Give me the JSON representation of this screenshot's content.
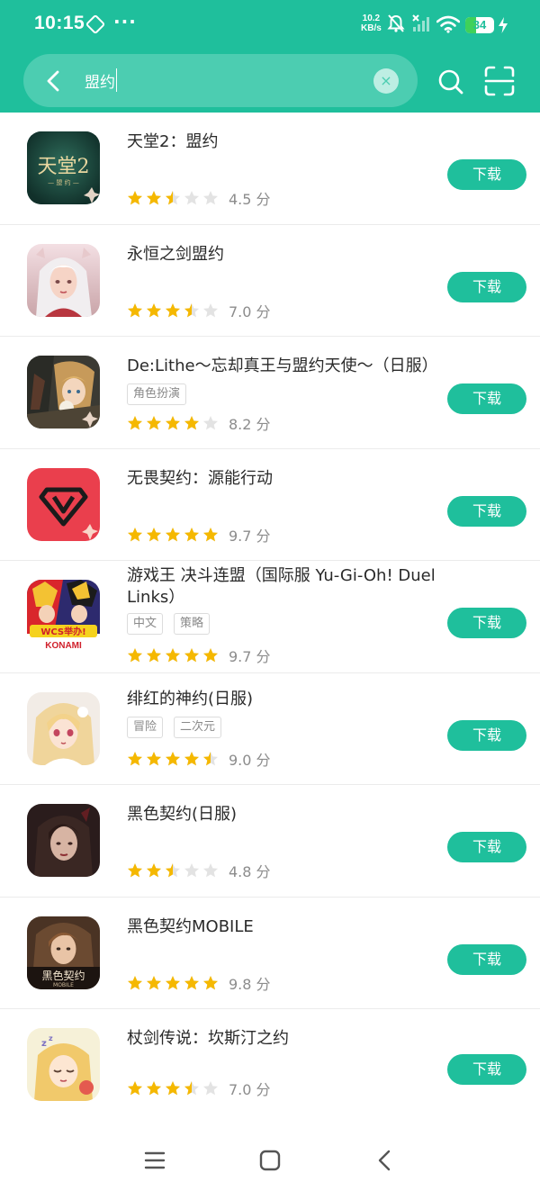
{
  "status_bar": {
    "time": "10:15",
    "dots": "···",
    "net_speed_value": "10.2",
    "net_speed_unit": "KB/s",
    "battery": "34"
  },
  "search": {
    "query": "盟约",
    "back_icon": "back-arrow-icon",
    "clear_icon": "clear-icon",
    "clear_glyph": "×",
    "search_icon": "search-icon",
    "scan_icon": "scan-icon"
  },
  "colors": {
    "accent": "#1fbf9c",
    "star": "#f5b800",
    "star_empty": "#e3e3e3"
  },
  "results": [
    {
      "name": "天堂2：盟约",
      "tags": [],
      "rating": 4.5,
      "stars": 2.5,
      "score_text": "4.5 分",
      "button": "下载",
      "icon": "lineage2-icon"
    },
    {
      "name": "永恒之剑盟约",
      "tags": [],
      "rating": 7.0,
      "stars": 3.5,
      "score_text": "7.0 分",
      "button": "下载",
      "icon": "anime-girl-icon"
    },
    {
      "name": "De:Lithe～忘却真王与盟约天使～（日服）",
      "tags": [
        "角色扮演"
      ],
      "rating": 8.2,
      "stars": 4,
      "score_text": "8.2 分",
      "button": "下载",
      "icon": "delithe-icon"
    },
    {
      "name": "无畏契约：源能行动",
      "tags": [],
      "rating": 9.7,
      "stars": 5,
      "score_text": "9.7 分",
      "button": "下载",
      "icon": "valorant-icon"
    },
    {
      "name": "游戏王 决斗连盟（国际服 Yu-Gi-Oh! Duel Links）",
      "tags": [
        "中文",
        "策略"
      ],
      "rating": 9.7,
      "stars": 5,
      "score_text": "9.7 分",
      "button": "下载",
      "icon": "yugioh-icon"
    },
    {
      "name": "绯红的神约(日服)",
      "tags": [
        "冒险",
        "二次元"
      ],
      "rating": 9.0,
      "stars": 4.5,
      "score_text": "9.0 分",
      "button": "下载",
      "icon": "blonde-girl-icon"
    },
    {
      "name": "黑色契约(日服)",
      "tags": [],
      "rating": 4.8,
      "stars": 2.5,
      "score_text": "4.8 分",
      "button": "下载",
      "icon": "dark-woman-icon"
    },
    {
      "name": "黑色契约MOBILE",
      "tags": [],
      "rating": 9.8,
      "stars": 5,
      "score_text": "9.8 分",
      "button": "下载",
      "icon": "black-contract-mobile-icon"
    },
    {
      "name": "杖剑传说：坎斯汀之约",
      "tags": [],
      "rating": 7.0,
      "stars": 3.5,
      "score_text": "7.0 分",
      "button": "下载",
      "icon": "sleeping-girl-icon"
    }
  ],
  "nav": {
    "menu_icon": "menu-icon",
    "home_icon": "home-icon",
    "back_icon": "back-icon"
  },
  "icon_text": {
    "lineage2_title": "天堂2",
    "lineage2_sub": "— 盟 约 —",
    "yugioh_badge": "WCS举办!",
    "yugioh_brand": "KONAMI",
    "black_mobile_title": "黑色契约",
    "black_mobile_sub": "MOBILE"
  }
}
